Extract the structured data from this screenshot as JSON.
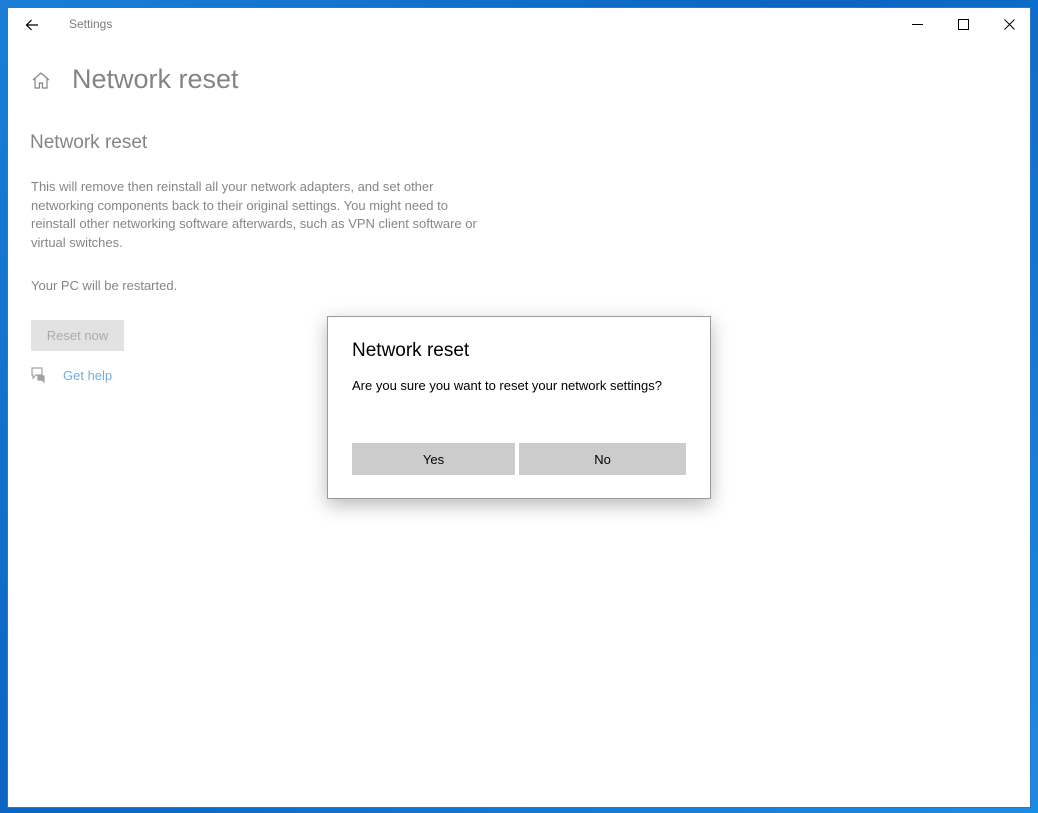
{
  "window": {
    "app_title": "Settings",
    "icons": {
      "back": "back-arrow-icon",
      "minimize": "minimize-icon",
      "maximize": "maximize-icon",
      "close": "close-icon"
    }
  },
  "page": {
    "title": "Network reset",
    "home_icon": "home-icon",
    "section_title": "Network reset",
    "description": "This will remove then reinstall all your network adapters, and set other networking components back to their original settings. You might need to reinstall other networking software afterwards, such as VPN client software or virtual switches.",
    "restart_note": "Your PC will be restarted.",
    "reset_button": "Reset now",
    "help_link": "Get help",
    "help_icon": "chat-help-icon"
  },
  "dialog": {
    "title": "Network reset",
    "message": "Are you sure you want to reset your network settings?",
    "yes_label": "Yes",
    "no_label": "No"
  },
  "colors": {
    "accent_link": "#0067c0",
    "button_gray": "#cccccc",
    "desktop_blue": "#0b63c4"
  }
}
